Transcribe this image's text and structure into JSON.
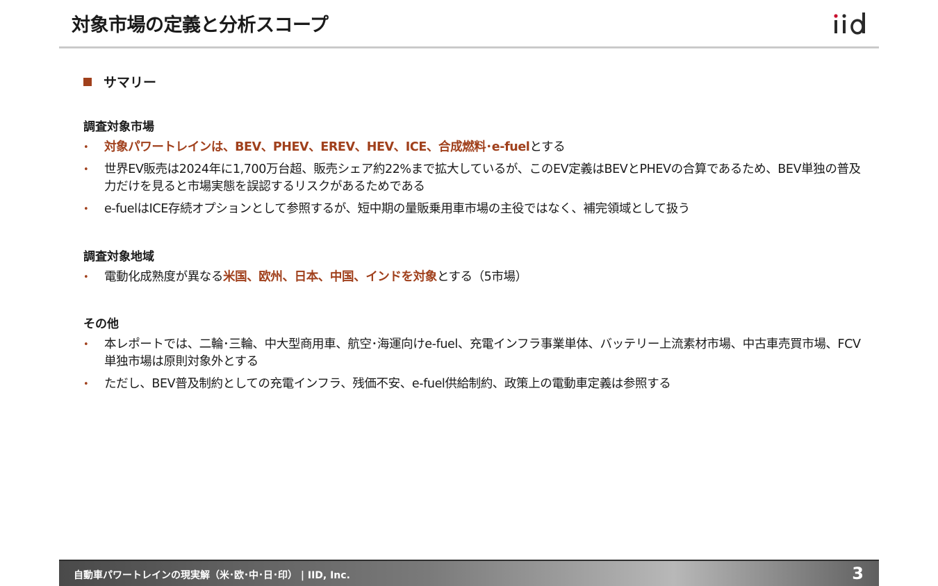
{
  "header": {
    "title": "対象市場の定義と分析スコープ",
    "logo_text": "iid"
  },
  "summary": {
    "label": "サマリー"
  },
  "sections": [
    {
      "heading": "調査対象市場",
      "bullets": [
        {
          "parts": [
            {
              "text": "対象パワートレインは、BEV、PHEV、EREV、HEV、ICE、合成燃料･e-fuel",
              "highlight": true
            },
            {
              "text": "とする",
              "highlight": false
            }
          ]
        },
        {
          "parts": [
            {
              "text": "世界EV販売は2024年に1,700万台超、販売シェア約22%まで拡大しているが、このEV定義はBEVとPHEVの合算であるため、BEV単独の普及力だけを見ると市場実態を誤認するリスクがあるためである",
              "highlight": false
            }
          ]
        },
        {
          "parts": [
            {
              "text": "e-fuelはICE存続オプションとして参照するが、短中期の量販乗用車市場の主役ではなく、補完領域として扱う",
              "highlight": false
            }
          ]
        }
      ]
    },
    {
      "heading": "調査対象地域",
      "bullets": [
        {
          "parts": [
            {
              "text": "電動化成熟度が異なる",
              "highlight": false
            },
            {
              "text": "米国、欧州、日本、中国、インドを対象",
              "highlight": true
            },
            {
              "text": "とする（5市場）",
              "highlight": false
            }
          ]
        }
      ]
    },
    {
      "heading": "その他",
      "bullets": [
        {
          "parts": [
            {
              "text": "本レポートでは、二輪･三輪、中大型商用車、航空･海運向けe-fuel、充電インフラ事業単体、バッテリー上流素材市場、中古車売買市場、FCV単独市場は原則対象外とする",
              "highlight": false
            }
          ]
        },
        {
          "parts": [
            {
              "text": "ただし、BEV普及制約としての充電インフラ、残価不安、e-fuel供給制約、政策上の電動車定義は参照する",
              "highlight": false
            }
          ]
        }
      ]
    }
  ],
  "footer": {
    "text": "自動車パワートレインの現実解（米･欧･中･日･印） |  IID, Inc.",
    "page_number": "3"
  },
  "colors": {
    "accent": "#a0401c",
    "logo_dot": "#c8102e",
    "text": "#1a1a1a"
  },
  "icons": {
    "summary_marker": "square-bullet-icon",
    "list_marker": "bullet-dot-icon"
  }
}
